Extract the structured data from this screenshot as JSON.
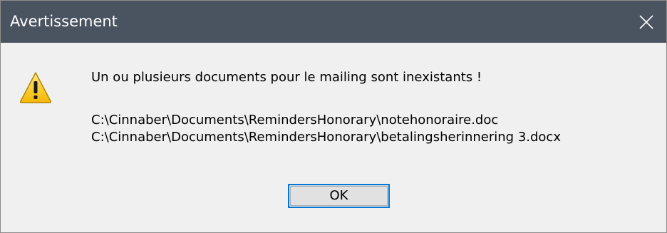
{
  "window": {
    "title": "Avertissement",
    "titlebar_color": "#4a5360",
    "close_icon": "close-icon"
  },
  "body": {
    "icon": "warning-icon",
    "message": "Un ou plusieurs documents pour le mailing sont inexistants !",
    "paths": [
      "C:\\Cinnaber\\Documents\\RemindersHonorary\\notehonoraire.doc",
      "C:\\Cinnaber\\Documents\\RemindersHonorary\\betalingsherinnering 3.docx"
    ]
  },
  "buttons": {
    "ok_label": "OK",
    "focus_color": "#0078d7"
  }
}
